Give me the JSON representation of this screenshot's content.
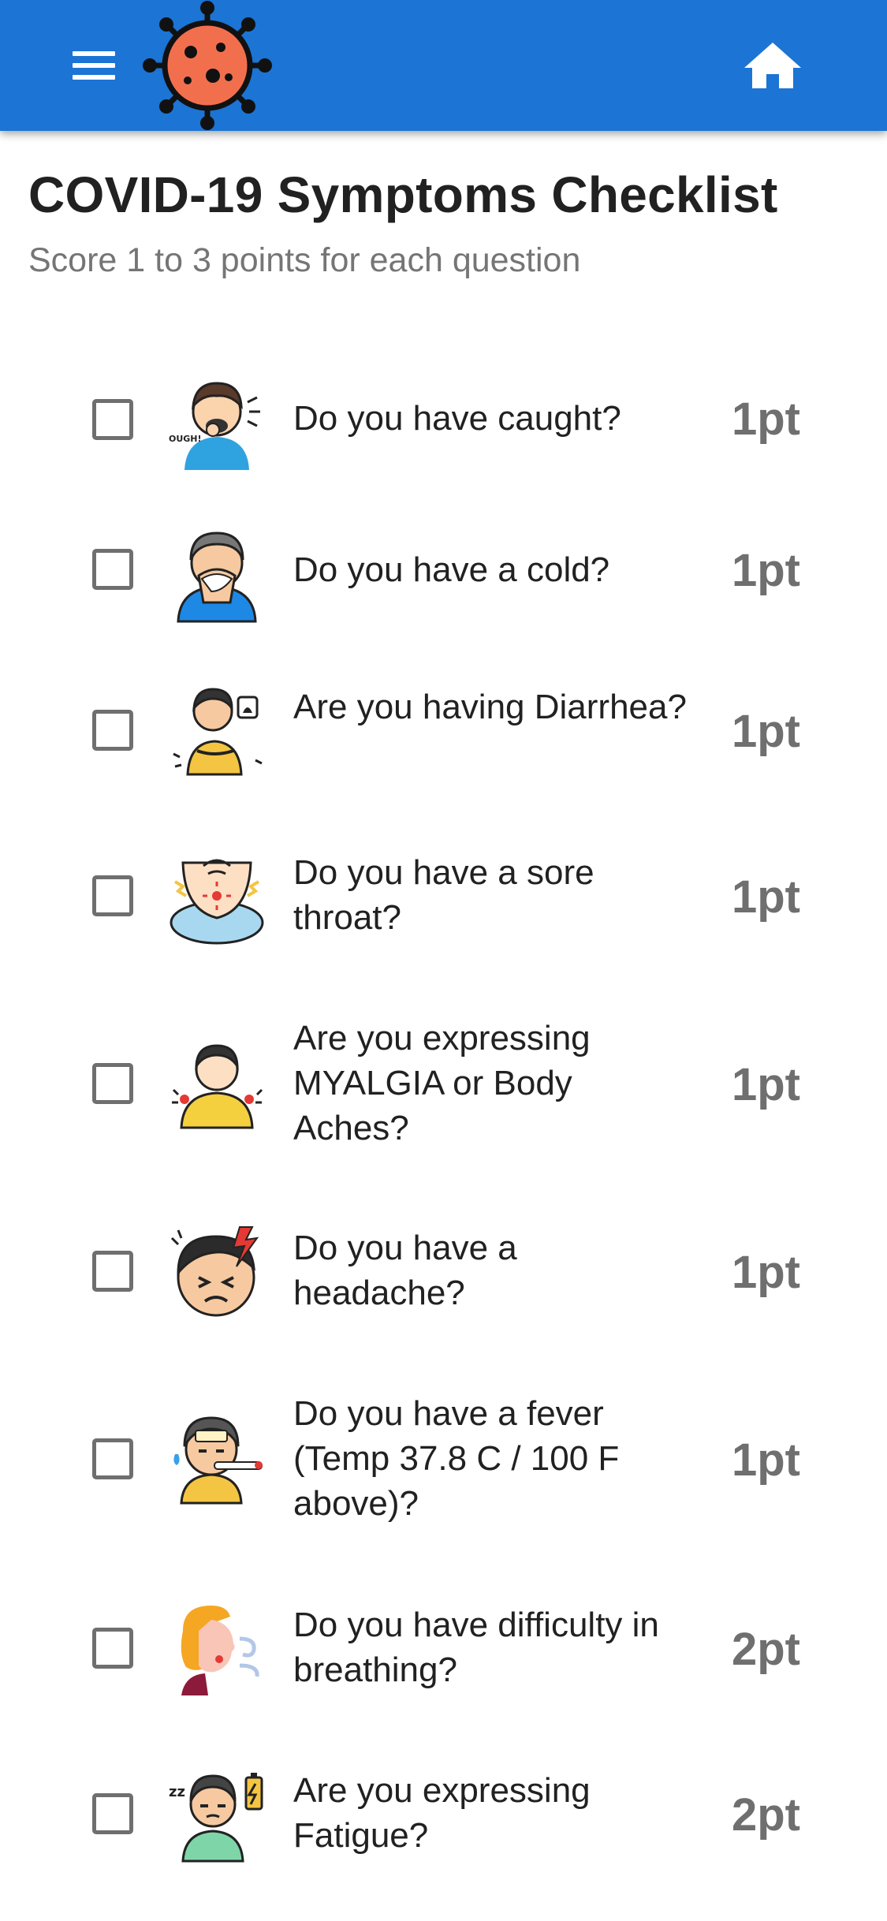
{
  "header": {
    "menu_icon": "hamburger-menu-icon",
    "logo_icon": "coronavirus-logo-icon",
    "home_icon": "home-icon",
    "colors": {
      "appbar": "#1c74d4",
      "virus_body": "#f26f4e",
      "virus_outline": "#111111"
    }
  },
  "page": {
    "title": "COVID-19 Symptoms Checklist",
    "subtitle": "Score 1 to 3 points for each question"
  },
  "symptoms": [
    {
      "question": "Do you have caught?",
      "points": "1pt",
      "checked": false,
      "icon": "coughing-person-icon"
    },
    {
      "question": "Do you have a cold?",
      "points": "1pt",
      "checked": false,
      "icon": "sneezing-person-icon"
    },
    {
      "question": "Are you having Diarrhea?",
      "points": "1pt",
      "checked": false,
      "icon": "diarrhea-person-icon"
    },
    {
      "question": "Do you have a sore throat?",
      "points": "1pt",
      "checked": false,
      "icon": "sore-throat-icon"
    },
    {
      "question": "Are you expressing MYALGIA or Body Aches?",
      "points": "1pt",
      "checked": false,
      "icon": "body-aches-icon"
    },
    {
      "question": "Do you have a headache?",
      "points": "1pt",
      "checked": false,
      "icon": "headache-icon"
    },
    {
      "question": "Do you have a fever (Temp 37.8 C / 100 F above)?",
      "points": "1pt",
      "checked": false,
      "icon": "fever-thermometer-icon"
    },
    {
      "question": "Do you have difficulty in breathing?",
      "points": "2pt",
      "checked": false,
      "icon": "breathing-difficulty-icon"
    },
    {
      "question": "Are you expressing Fatigue?",
      "points": "2pt",
      "checked": false,
      "icon": "fatigue-icon"
    }
  ]
}
